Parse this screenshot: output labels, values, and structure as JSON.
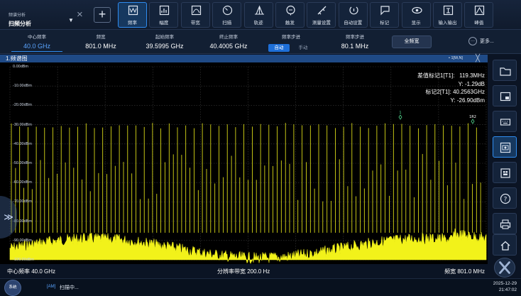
{
  "mode": {
    "subtitle": "频谱分析",
    "title": "扫频分析"
  },
  "toolbar": {
    "items": [
      {
        "label": "频率",
        "icon": "frequency-icon",
        "active": true
      },
      {
        "label": "幅度",
        "icon": "amplitude-icon",
        "active": false
      },
      {
        "label": "带宽",
        "icon": "bandwidth-icon",
        "active": false
      },
      {
        "label": "扫描",
        "icon": "sweep-icon",
        "active": false
      },
      {
        "label": "轨迹",
        "icon": "trace-icon",
        "active": false
      },
      {
        "label": "触发",
        "icon": "trigger-icon",
        "active": false
      },
      {
        "label": "测量设置",
        "icon": "measure-setup-icon",
        "active": false
      },
      {
        "label": "自动设置",
        "icon": "auto-setup-icon",
        "active": false
      },
      {
        "label": "标记",
        "icon": "marker-icon",
        "active": false
      },
      {
        "label": "显示",
        "icon": "display-icon",
        "active": false
      },
      {
        "label": "输入输出",
        "icon": "input-output-icon",
        "active": false
      },
      {
        "label": "峰值",
        "icon": "peak-icon",
        "active": false
      }
    ]
  },
  "params": {
    "center_label": "中心频率",
    "center_value": "40.0 GHz",
    "span_label": "频宽",
    "span_value": "801.0 MHz",
    "start_label": "起始频率",
    "start_value": "39.5995 GHz",
    "stop_label": "终止频率",
    "stop_value": "40.4005 GHz",
    "step_label": "频率步进",
    "step_auto": "自动",
    "step_manual": "手动",
    "step2_label": "频率步进",
    "step2_value": "80.1 MHz",
    "full_span": "全频宽",
    "more": "更多..."
  },
  "window": {
    "title": "1.频谱图",
    "trace_info": "• 1[W,N]",
    "close": "╳"
  },
  "plot": {
    "y_ticks": [
      "0.00dBm",
      "-10.00dBm",
      "-20.00dBm",
      "-30.00dBm",
      "-40.00dBm",
      "-50.00dBm",
      "-60.00dBm",
      "-70.00dBm",
      "-80.00dBm",
      "-90.00dBm",
      "-100.00dBm"
    ],
    "ref_level_dbm": 0,
    "scale_db_per_div": 10,
    "trace_color": "#f2f21a",
    "marker_labels": [
      "1",
      "1R2"
    ]
  },
  "markers": {
    "line1_label": "差值标记1[T1]:",
    "line1_value": "119.3MHz",
    "line2": "Y: -1.29dB",
    "line3_label": "标记2[T1]:",
    "line3_value": "40.2563GHz",
    "line4": "Y: -26.90dBm"
  },
  "bottom": {
    "center": "中心频率 40.0 GHz",
    "rbw": "分辨率带宽 200.0 Hz",
    "span": "频宽 801.0 MHz"
  },
  "status": {
    "system_btn": "系统",
    "icon_text": "[AM]",
    "text": "扫描中...",
    "date": "2025-12-29",
    "time": "21:47:02"
  },
  "side": [
    "folder-icon",
    "window-layout-icon",
    "keypad-icon",
    "screenshot-icon",
    "preset-icon",
    "help-icon",
    "print-icon",
    "home-icon"
  ]
}
